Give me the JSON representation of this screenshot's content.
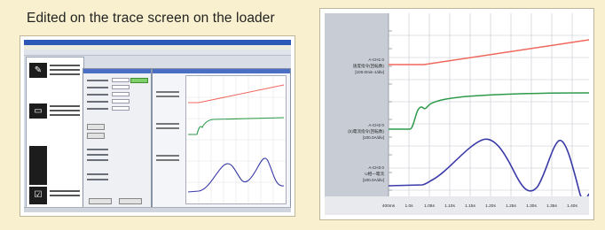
{
  "caption": "Edited on the trace screen on the loader",
  "colors": {
    "page_bg": "#f8f0cf",
    "trace_red": "#f0675c",
    "trace_green": "#2e9a4a",
    "trace_blue": "#3a3aa8",
    "scope_left_bg": "#c7ccd5",
    "grid": "#d3d6da"
  },
  "loader_screenshot": {
    "sidebar_icons": [
      "pencil-icon",
      "monitor-icon",
      "checkbox-icon"
    ]
  },
  "scope": {
    "channels": [
      {
        "id": "A-CH1 0",
        "name": "速度指令(回転数)",
        "scale": "[100.0min-1/div]"
      },
      {
        "id": "A-CH2 0",
        "name": "(b)電流指令(回転数)",
        "scale": "[100.0A/div]"
      },
      {
        "id": "A-CH3 0",
        "name": "U相一電流",
        "scale": "[100.0A/div]"
      }
    ],
    "x_ticks": [
      "400ms",
      "1.0s",
      "1.05s",
      "1.10s",
      "1.15s",
      "1.20s",
      "1.25s",
      "1.30s",
      "1.35s",
      "1.40s"
    ]
  }
}
